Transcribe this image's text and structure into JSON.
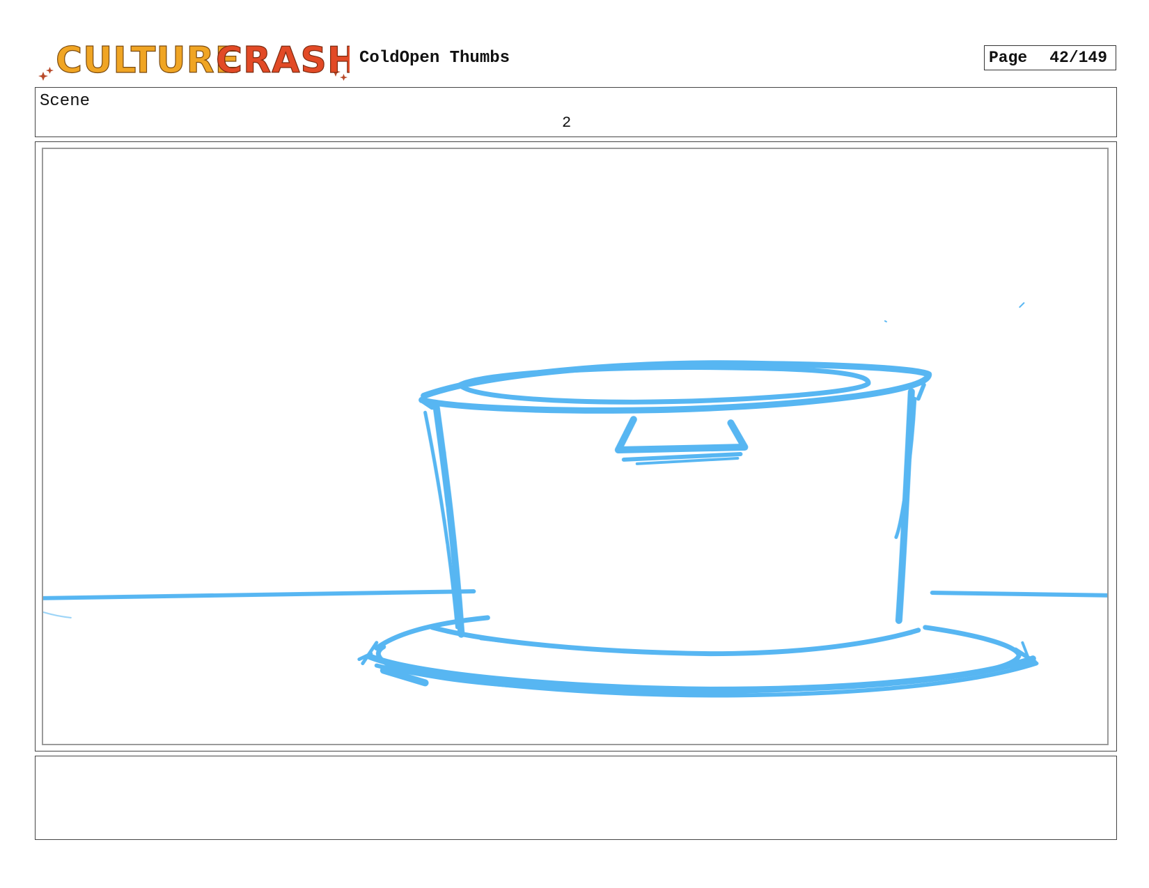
{
  "header": {
    "logo_text": "CULTURE CRASH",
    "logo_word1": "CULTURE",
    "logo_word2": "CRASH",
    "project_title": "ColdOpen Thumbs",
    "page_label": "Page",
    "page_number": "42/149"
  },
  "scene": {
    "label": "Scene",
    "number": "2"
  },
  "panel": {
    "sketch_color": "#4fb3f2",
    "subject": "pot-sketch"
  },
  "notes": {
    "text": ""
  },
  "colors": {
    "logo_orange": "#f0a524",
    "logo_red": "#e24a26",
    "logo_star": "#b84a2a"
  }
}
